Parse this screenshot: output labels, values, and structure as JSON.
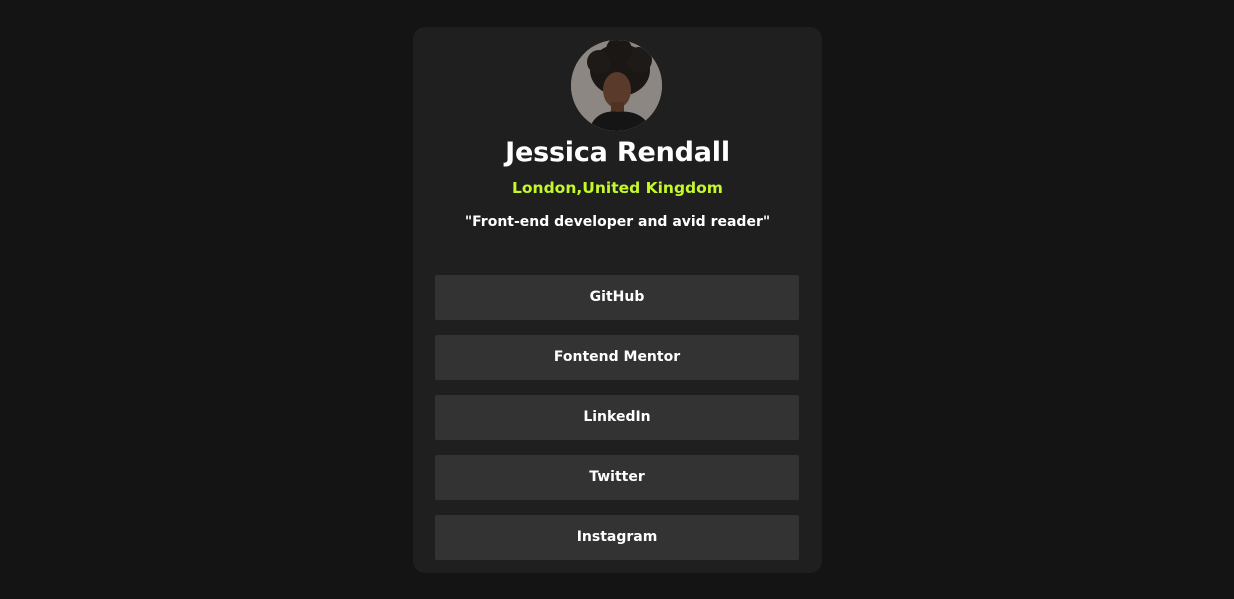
{
  "profile": {
    "name": "Jessica Rendall",
    "location": "London,United Kingdom",
    "bio": "\"Front-end developer and avid reader\""
  },
  "links": [
    {
      "label": "GitHub"
    },
    {
      "label": "Fontend Mentor"
    },
    {
      "label": "LinkedIn"
    },
    {
      "label": "Twitter"
    },
    {
      "label": "Instagram"
    }
  ],
  "colors": {
    "page_background": "#141414",
    "card_background": "#1f1f1f",
    "button_background": "#333333",
    "accent": "#c4f82a",
    "text": "#ffffff"
  }
}
